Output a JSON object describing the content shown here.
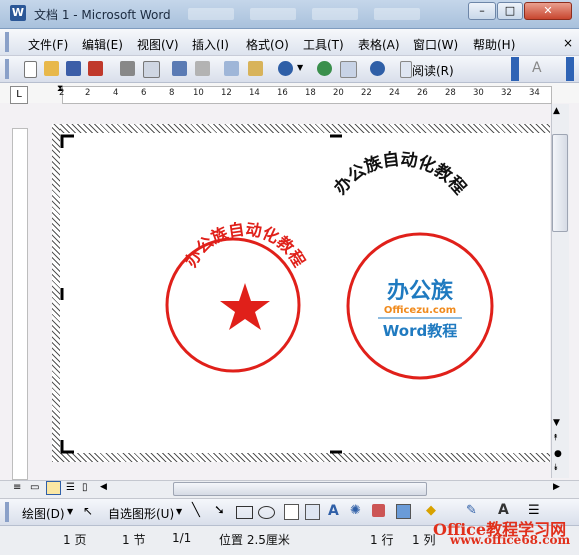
{
  "window": {
    "title": "文档 1 - Microsoft Word",
    "min": "–",
    "max": "□",
    "close": "✕"
  },
  "menu": [
    "文件(F)",
    "编辑(E)",
    "视图(V)",
    "插入(I)",
    "格式(O)",
    "工具(T)",
    "表格(A)",
    "窗口(W)",
    "帮助(H)"
  ],
  "toolbar": {
    "read_label": "阅读(R)",
    "style_button": "A"
  },
  "ruler": {
    "corner": "L",
    "ticks": [
      "2",
      "2",
      "4",
      "6",
      "8",
      "10",
      "12",
      "14",
      "16",
      "18",
      "20",
      "22",
      "24",
      "26",
      "28",
      "30",
      "32",
      "34"
    ]
  },
  "document": {
    "arc_text": "办公族自动化教程",
    "stamp1_text": "办公族自动化教程",
    "logo_main": "办公族",
    "logo_site": "Officezu.com",
    "logo_sub": "Word教程"
  },
  "drawing_toolbar": {
    "draw": "绘图(D)",
    "autoshapes": "自选图形(U)"
  },
  "status": {
    "page": "1 页",
    "section": "1 节",
    "pages": "1/1",
    "position": "位置 2.5厘米",
    "line": "1 行",
    "col": "1 列"
  },
  "watermark": {
    "text": "Office教程学习网",
    "url": "www.office68.com"
  },
  "colors": {
    "stamp_red": "#e0201a",
    "logo_blue": "#1f7ac0",
    "logo_orange": "#f08a1c"
  }
}
